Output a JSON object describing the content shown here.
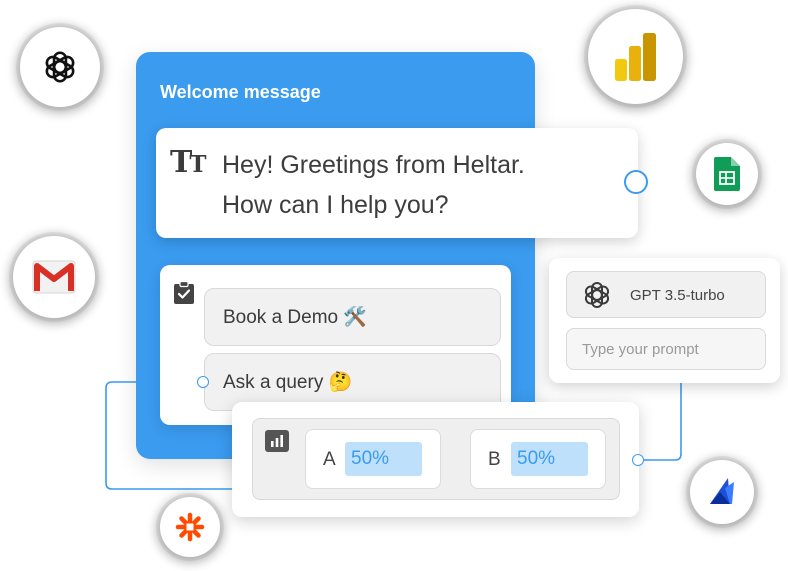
{
  "flow": {
    "title": "Welcome message",
    "greeting": {
      "line1": "Hey! Greetings from Heltar.",
      "line2": "How can I help you?"
    },
    "options": [
      {
        "label": "Book a Demo 🛠️"
      },
      {
        "label": "Ask a query 🤔"
      }
    ]
  },
  "ab_split": {
    "variants": [
      {
        "letter": "A",
        "value": "50%"
      },
      {
        "letter": "B",
        "value": "50%"
      }
    ]
  },
  "gpt": {
    "model_label": "GPT 3.5-turbo",
    "prompt_placeholder": "Type your prompt",
    "prompt_value": ""
  },
  "integrations": [
    {
      "icon": "openai-icon"
    },
    {
      "icon": "power-bi-icon"
    },
    {
      "icon": "google-sheets-icon"
    },
    {
      "icon": "gmail-icon"
    },
    {
      "icon": "zapier-icon"
    },
    {
      "icon": "dynamics-icon"
    }
  ],
  "colors": {
    "primary_blue": "#3a9bef",
    "value_highlight": "#bfe0fb",
    "zapier_orange": "#ff4a00",
    "sheets_green": "#0f9d58",
    "gmail_red": "#d93025",
    "powerbi_yellow": "#f2c811"
  }
}
